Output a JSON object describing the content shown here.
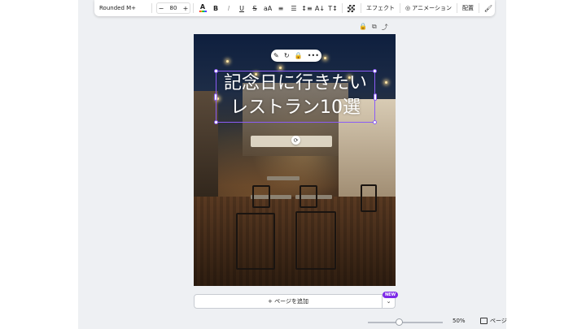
{
  "toolbar": {
    "font_name": "Rounded M+",
    "minus": "−",
    "font_size": "80",
    "plus": "+",
    "color_glyph": "A",
    "bold": "B",
    "italic": "I",
    "underline": "U",
    "strike": "S",
    "case": "aA",
    "align": "≡",
    "list": "☰",
    "spacing": "↕≡",
    "vertical": "A↓",
    "resize": "T↕",
    "effects_label": "エフェクト",
    "animate_label": "アニメーション",
    "position_label": "配置",
    "paint_glyph": "🖌"
  },
  "page_icons": {
    "lock": "🔒",
    "duplicate": "⧉",
    "add": "⤴"
  },
  "context_menu": {
    "edit": "✎",
    "refresh": "↻",
    "lock": "🔒",
    "more": "•••"
  },
  "canvas": {
    "headline_line1": "記念日に行きたい",
    "headline_line2": "レストラン10選"
  },
  "rotate_glyph": "⟳",
  "bottom": {
    "add_page_label": "+ ページを追加",
    "chevron": "⌄",
    "new_badge": "NEW",
    "zoom_percent": 50,
    "zoom_label": "50%",
    "pages_label": "ページ"
  }
}
